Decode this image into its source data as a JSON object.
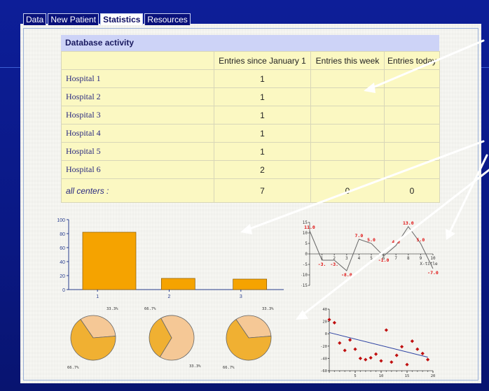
{
  "tabs": [
    {
      "label": "Data",
      "active": false
    },
    {
      "label": "New Patient",
      "active": false
    },
    {
      "label": "Statistics",
      "active": true
    },
    {
      "label": "Resources",
      "active": false
    }
  ],
  "activity": {
    "title": "Database activity",
    "columns": [
      "",
      "Entries since January 1",
      "Entries this week",
      "Entries today"
    ],
    "rows": [
      {
        "name": "Hospital 1",
        "since_jan": "1",
        "week": "",
        "today": ""
      },
      {
        "name": "Hospital 2",
        "since_jan": "1",
        "week": "",
        "today": ""
      },
      {
        "name": "Hospital 3",
        "since_jan": "1",
        "week": "",
        "today": ""
      },
      {
        "name": "Hospital 4",
        "since_jan": "1",
        "week": "",
        "today": ""
      },
      {
        "name": "Hospital 5",
        "since_jan": "1",
        "week": "",
        "today": ""
      },
      {
        "name": "Hospital 6",
        "since_jan": "2",
        "week": "",
        "today": ""
      }
    ],
    "total": {
      "name": "all centers :",
      "since_jan": "7",
      "week": "0",
      "today": "0"
    }
  },
  "chart_data": [
    {
      "type": "bar",
      "categories": [
        "1",
        "2",
        "3"
      ],
      "values": [
        82,
        16,
        15
      ],
      "ylim": [
        0,
        100
      ],
      "yticks": [
        "0",
        "20",
        "40",
        "60",
        "80",
        "100"
      ],
      "color": "#f5a300"
    },
    {
      "type": "line",
      "x": [
        0,
        1,
        2,
        3,
        4,
        5,
        6,
        7,
        8,
        9,
        10
      ],
      "y": [
        11.0,
        -3.0,
        -3.0,
        -8.0,
        7.0,
        5.0,
        -1.0,
        4.0,
        13.0,
        5.0,
        -7.0
      ],
      "point_labels": [
        "11.0",
        "-3.",
        "-3.",
        "-8.0",
        "7.0",
        "5.0",
        "-1.0",
        "4.0",
        "13.0",
        "5.0",
        "-7.0"
      ],
      "xlabel": "X-title",
      "ylim": [
        -15,
        15
      ],
      "yticks": [
        "15",
        "10",
        "5",
        "0",
        "-5",
        "-10",
        "-15"
      ],
      "xticks": [
        "1",
        "2",
        "3",
        "4",
        "5",
        "6",
        "7",
        "8",
        "9",
        "10"
      ]
    },
    {
      "type": "pie",
      "slices": [
        {
          "label": "33.3%",
          "value": 33.3,
          "color": "#f5c896"
        },
        {
          "label": "66.7%",
          "value": 66.7,
          "color": "#f0b032"
        }
      ]
    },
    {
      "type": "pie",
      "slices": [
        {
          "label": "66.7%",
          "value": 66.7,
          "color": "#f5c896"
        },
        {
          "label": "33.3%",
          "value": 33.3,
          "color": "#f0b032"
        }
      ]
    },
    {
      "type": "pie",
      "slices": [
        {
          "label": "33.3%",
          "value": 33.3,
          "color": "#f5c896"
        },
        {
          "label": "66.7%",
          "value": 66.7,
          "color": "#f0b032"
        }
      ]
    },
    {
      "type": "scatter",
      "x": [
        0,
        1,
        2,
        3,
        4,
        5,
        6,
        7,
        8,
        9,
        10,
        11,
        12,
        13,
        14,
        15,
        16,
        17,
        18,
        19
      ],
      "y": [
        23,
        18,
        -15,
        -27,
        -10,
        -25,
        -40,
        -42,
        -39,
        -33,
        -44,
        6,
        -46,
        -35,
        -21,
        -50,
        -12,
        -25,
        -32,
        -42
      ],
      "trend": [
        2,
        -38
      ],
      "ylim": [
        -60,
        40
      ],
      "yticks": [
        "40",
        "20",
        "0",
        "-20",
        "-40",
        "-60"
      ],
      "xticks": [
        "5",
        "10",
        "15",
        "20"
      ]
    }
  ]
}
